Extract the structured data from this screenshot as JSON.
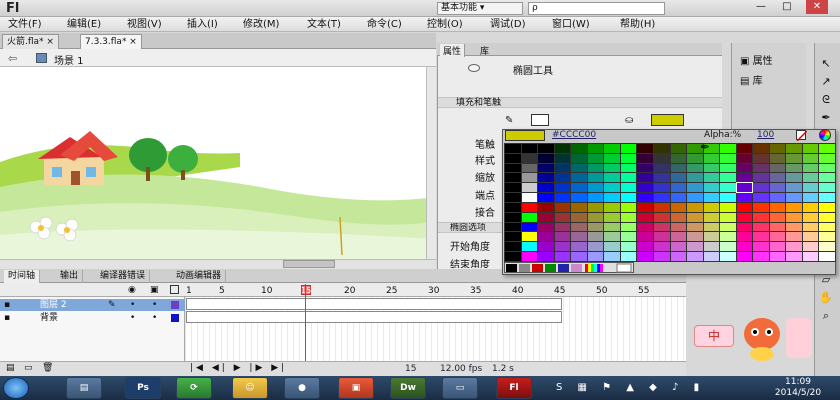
{
  "window": {
    "logo": "Fl",
    "workspace": "基本功能 ▾",
    "search_placeholder": "ρ",
    "min": "—",
    "max": "□",
    "close": "✕"
  },
  "menu": [
    {
      "label": "文件(F)"
    },
    {
      "label": "编辑(E)"
    },
    {
      "label": "视图(V)"
    },
    {
      "label": "插入(I)"
    },
    {
      "label": "修改(M)"
    },
    {
      "label": "文本(T)"
    },
    {
      "label": "命令(C)"
    },
    {
      "label": "控制(O)"
    },
    {
      "label": "调试(D)"
    },
    {
      "label": "窗口(W)"
    },
    {
      "label": "帮助(H)"
    }
  ],
  "doc_tabs": [
    {
      "label": "火箭.fla* ×"
    },
    {
      "label": "7.3.3.fla* ×"
    }
  ],
  "scene": {
    "label": "场景 1"
  },
  "timeline": {
    "tabs": [
      {
        "label": "时间轴"
      },
      {
        "label": "输出"
      },
      {
        "label": "编译器错误"
      },
      {
        "label": "动画编辑器"
      }
    ],
    "ruler": [
      "1",
      "5",
      "10",
      "15",
      "20",
      "25",
      "30",
      "35",
      "40",
      "45",
      "50",
      "55"
    ],
    "current_frame": "15",
    "layers": [
      {
        "name": "图层 2"
      },
      {
        "name": "背景"
      }
    ],
    "footer": {
      "frame": "15",
      "fps": "12.00 fps",
      "time": "1.2 s"
    }
  },
  "properties": {
    "tabs": [
      {
        "label": "属性"
      },
      {
        "label": "库"
      }
    ],
    "tool_name": "椭圆工具",
    "section_fill": "填充和笔触",
    "rows": [
      {
        "label": "笔触"
      },
      {
        "label": "样式"
      },
      {
        "label": "缩放"
      },
      {
        "label": "端点"
      },
      {
        "label": "接合"
      }
    ],
    "section_ellipse": "椭圆选项",
    "start_angle": "开始角度",
    "end_angle": "结束角度",
    "fill_color": "#cccc00"
  },
  "dock": {
    "items": [
      {
        "label": "属性"
      },
      {
        "label": "库"
      }
    ]
  },
  "color_popup": {
    "hex": "#CCCC00",
    "alpha_label": "Alpha:%",
    "alpha_value": "100"
  },
  "taskbar": {
    "apps": [
      {
        "label": "Ps"
      },
      {
        "label": "Dw"
      },
      {
        "label": "Fl"
      }
    ],
    "time": "11:09",
    "date": "2014/5/20",
    "ime": "中"
  },
  "colors": {
    "accent": "#cccc00",
    "playhead": "#dd3333",
    "layer_selected": "#7fa7d9"
  }
}
